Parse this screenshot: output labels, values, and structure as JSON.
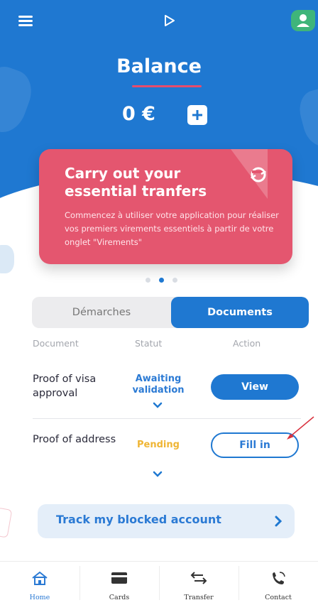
{
  "header": {
    "balance_title": "Balance",
    "balance_amount": "0 €"
  },
  "promo": {
    "title": "Carry out your essential tranfers",
    "text": "Commencez à utiliser votre application pour réaliser vos premiers virements essentiels à partir de votre onglet \"Virements\""
  },
  "carousel": {
    "count": 3,
    "active": 2
  },
  "tabs": {
    "demarches": "Démarches",
    "documents": "Documents",
    "active": "documents"
  },
  "table": {
    "headers": {
      "document": "Document",
      "status": "Statut",
      "action": "Action"
    },
    "rows": [
      {
        "name": "Proof of visa approval",
        "status": "Awaiting validation",
        "action": "View"
      },
      {
        "name": "Proof of address",
        "status": "Pending",
        "action": "Fill in"
      }
    ]
  },
  "track": {
    "label": "Track my blocked account"
  },
  "nav": {
    "items": [
      {
        "label": "Home",
        "icon": "home-icon",
        "active": true
      },
      {
        "label": "Cards",
        "icon": "card-icon"
      },
      {
        "label": "Transfer",
        "icon": "transfer-icon"
      },
      {
        "label": "Contact",
        "icon": "phone-icon"
      }
    ]
  },
  "colors": {
    "primary": "#1f78d1",
    "promo": "#e4566f",
    "pending": "#efb534"
  }
}
